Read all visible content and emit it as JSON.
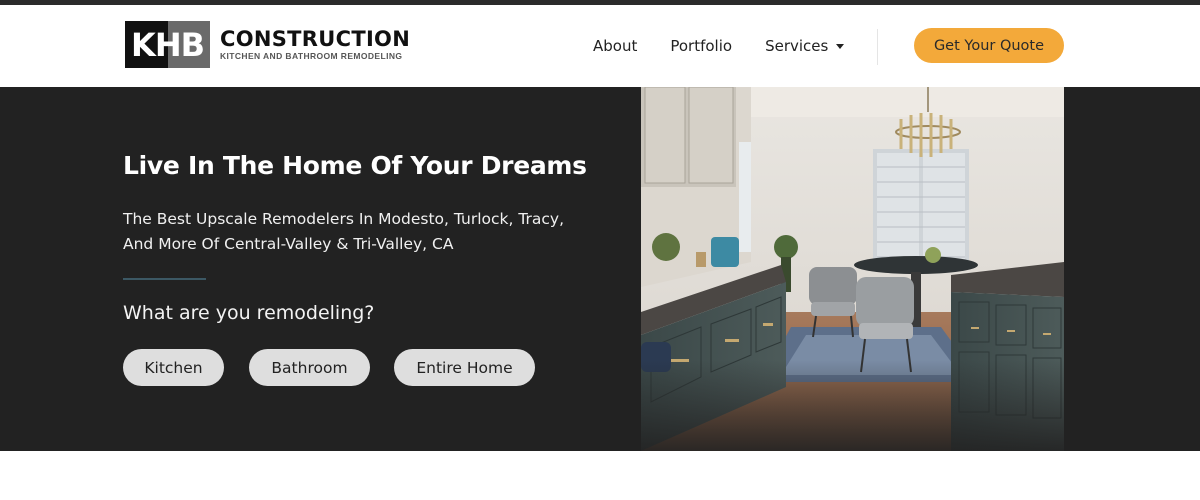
{
  "brand": {
    "logo_letters": "KHB",
    "name": "CONSTRUCTION",
    "tagline": "KITCHEN AND BATHROOM REMODELING"
  },
  "nav": {
    "items": [
      {
        "label": "About"
      },
      {
        "label": "Portfolio"
      },
      {
        "label": "Services"
      }
    ],
    "cta_label": "Get Your Quote"
  },
  "hero": {
    "title": "Live In The Home Of Your Dreams",
    "subtitle": "The Best Upscale Remodelers In Modesto, Turlock, Tracy, And More Of Central-Valley & Tri-Valley, CA",
    "question": "What are you remodeling?",
    "options": [
      "Kitchen",
      "Bathroom",
      "Entire Home"
    ]
  },
  "colors": {
    "hero_bg": "#222222",
    "accent": "#f3a93a",
    "pill_bg": "#dedede",
    "rule": "#3c5864"
  },
  "icons": {
    "services_dropdown": "chevron-down-icon"
  }
}
